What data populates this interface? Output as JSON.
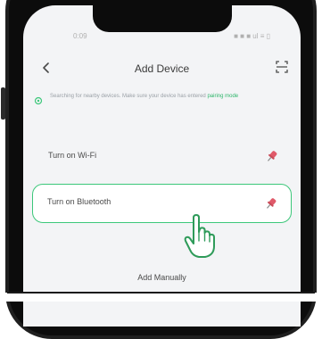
{
  "status_bar": {
    "left_text": "0:09",
    "right_text": "■ ■ ■ ul ≡ ▯"
  },
  "nav": {
    "title": "Add Device",
    "back_icon": "chevron-left-icon",
    "scan_icon": "scan-icon"
  },
  "hint": {
    "text": "Searching for nearby devices. Make sure your device has entered",
    "link": "pairing mode"
  },
  "options": [
    {
      "label": "Turn on Wi-Fi",
      "icon": "pin-icon",
      "highlighted": false
    },
    {
      "label": "Turn on Bluetooth",
      "icon": "pin-icon",
      "highlighted": true
    }
  ],
  "add_manually": {
    "label": "Add Manually"
  },
  "colors": {
    "accent": "#3cc77a",
    "link": "#2db56a",
    "pin": "#e05a6a",
    "screen_bg": "#f3f4f6"
  }
}
